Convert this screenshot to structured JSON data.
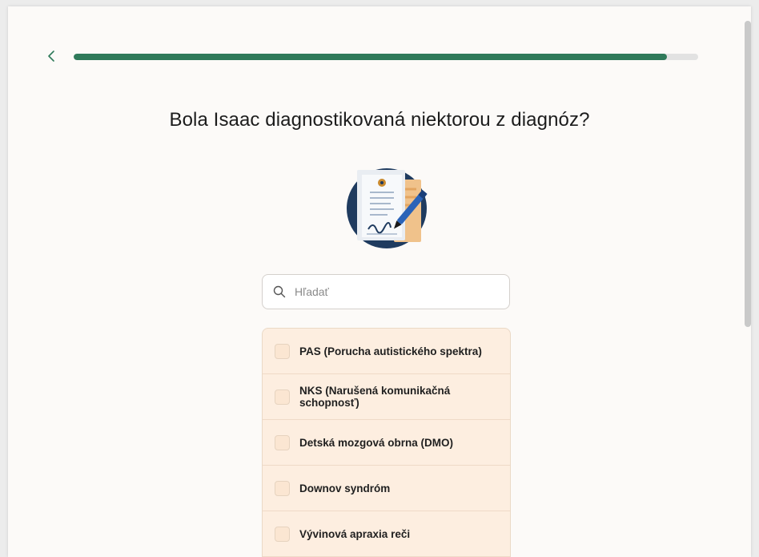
{
  "progress": {
    "percent": 95
  },
  "colors": {
    "accent": "#2f7a5a",
    "option_bg": "#fdeee0",
    "illustration_bg": "#1f3b5f"
  },
  "header": {
    "back_icon": "chevron-left-icon"
  },
  "question": {
    "title": "Bola Isaac diagnostikovaná niektorou z diagnóz?"
  },
  "illustration": {
    "icon": "signed-document-icon"
  },
  "search": {
    "icon": "search-icon",
    "placeholder": "Hľadať",
    "value": ""
  },
  "options": [
    {
      "label": "PAS (Porucha autistického spektra)",
      "checked": false
    },
    {
      "label": "NKS (Narušená komunikačná schopnosť)",
      "checked": false
    },
    {
      "label": "Detská mozgová obrna (DMO)",
      "checked": false
    },
    {
      "label": "Downov syndróm",
      "checked": false
    },
    {
      "label": "Vývinová apraxia reči",
      "checked": false
    }
  ]
}
